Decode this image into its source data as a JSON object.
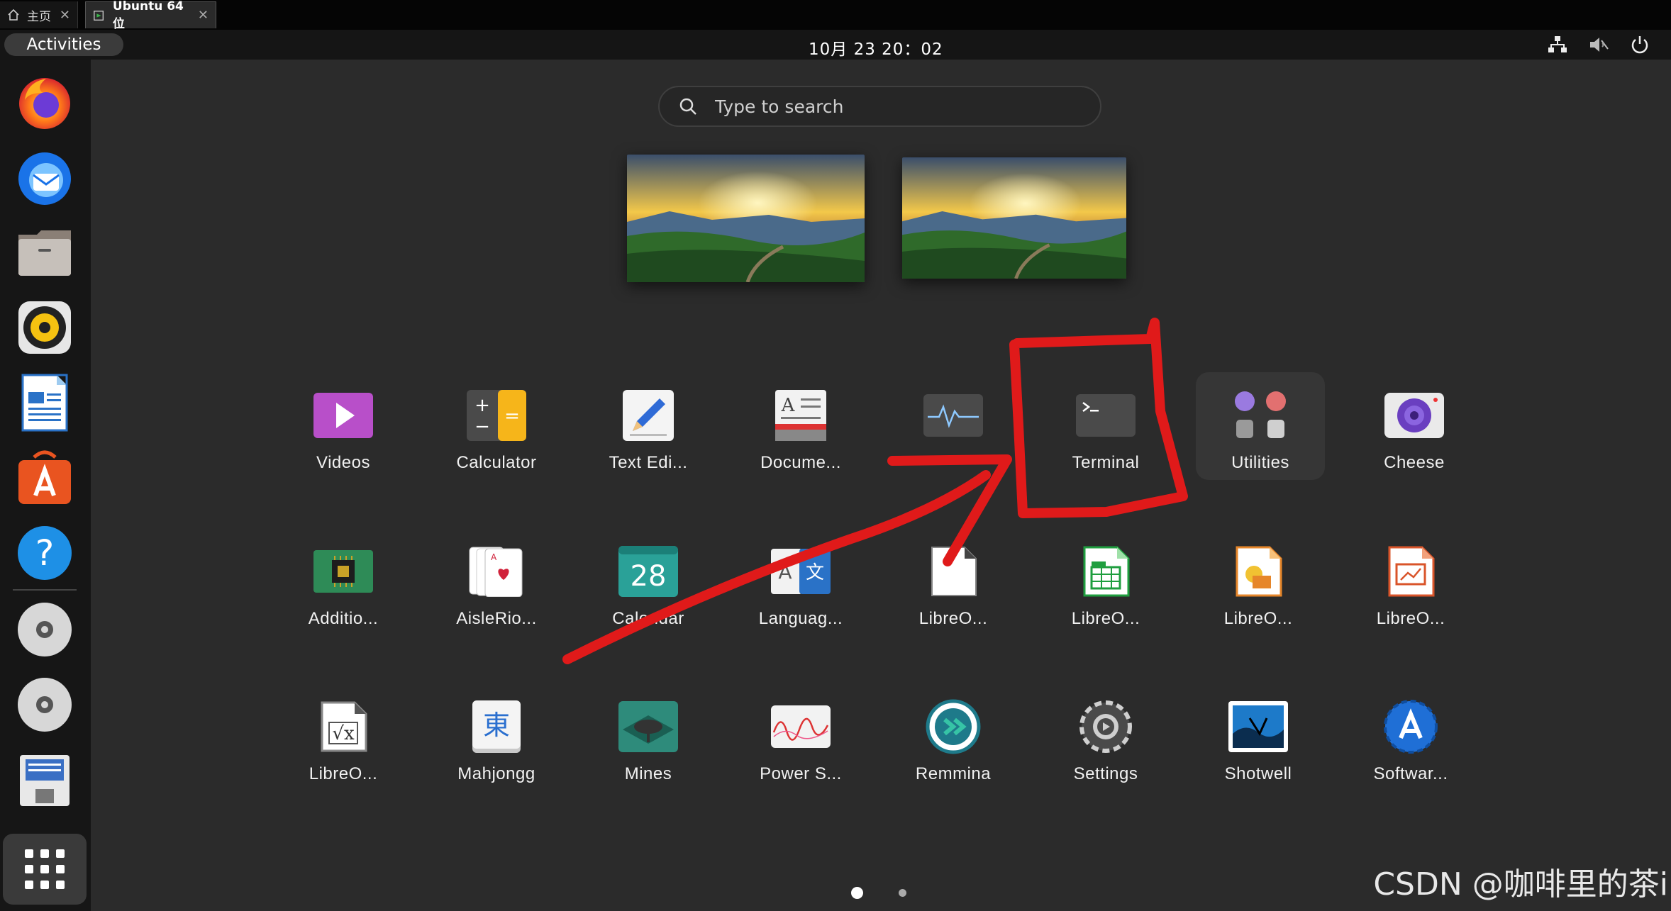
{
  "vm_tabs": [
    {
      "label": "主页",
      "icon": "home-icon"
    },
    {
      "label": "Ubuntu 64 位",
      "icon": "vm-icon"
    }
  ],
  "topbar": {
    "activities_label": "Activities",
    "clock": "10月 23  20：02",
    "tray_icons": [
      "network-icon",
      "volume-muted-icon",
      "power-icon"
    ]
  },
  "dock": {
    "items": [
      "firefox-icon",
      "thunderbird-icon",
      "files-icon",
      "rhythmbox-icon",
      "libreoffice-writer-icon",
      "app-center-icon",
      "help-icon",
      "cd-drive-icon",
      "cd-drive-icon",
      "floppy-disk-icon"
    ],
    "apps_button": "show-apps-icon"
  },
  "search": {
    "placeholder": "Type to search"
  },
  "apps": [
    {
      "label": "Videos",
      "icon": "videos-icon"
    },
    {
      "label": "Calculator",
      "icon": "calculator-icon"
    },
    {
      "label": "Text Edi...",
      "icon": "text-editor-icon"
    },
    {
      "label": "Docume...",
      "icon": "document-viewer-icon"
    },
    {
      "label": "",
      "icon": "system-monitor-icon"
    },
    {
      "label": "Terminal",
      "icon": "terminal-icon"
    },
    {
      "label": "Utilities",
      "icon": "utilities-folder-icon"
    },
    {
      "label": "Cheese",
      "icon": "cheese-icon"
    },
    {
      "label": "Additio...",
      "icon": "additional-drivers-icon"
    },
    {
      "label": "AisleRio...",
      "icon": "aisleriot-icon"
    },
    {
      "label": "Calendar",
      "icon": "calendar-icon"
    },
    {
      "label": "Languag...",
      "icon": "language-support-icon"
    },
    {
      "label": "LibreO...",
      "icon": "libreoffice-icon"
    },
    {
      "label": "LibreO...",
      "icon": "libreoffice-calc-icon"
    },
    {
      "label": "LibreO...",
      "icon": "libreoffice-draw-icon"
    },
    {
      "label": "LibreO...",
      "icon": "libreoffice-impress-icon"
    },
    {
      "label": "LibreO...",
      "icon": "libreoffice-math-icon"
    },
    {
      "label": "Mahjongg",
      "icon": "mahjongg-icon"
    },
    {
      "label": "Mines",
      "icon": "mines-icon"
    },
    {
      "label": "Power S...",
      "icon": "power-statistics-icon"
    },
    {
      "label": "Remmina",
      "icon": "remmina-icon"
    },
    {
      "label": "Settings",
      "icon": "settings-icon"
    },
    {
      "label": "Shotwell",
      "icon": "shotwell-icon"
    },
    {
      "label": "Softwar...",
      "icon": "software-icon"
    }
  ],
  "calendar_day": "28",
  "mahjongg_glyph": "東",
  "pages": {
    "count": 2,
    "current": 1
  },
  "annotation_color": "#e01a1a",
  "watermark": "CSDN @咖啡里的茶i"
}
